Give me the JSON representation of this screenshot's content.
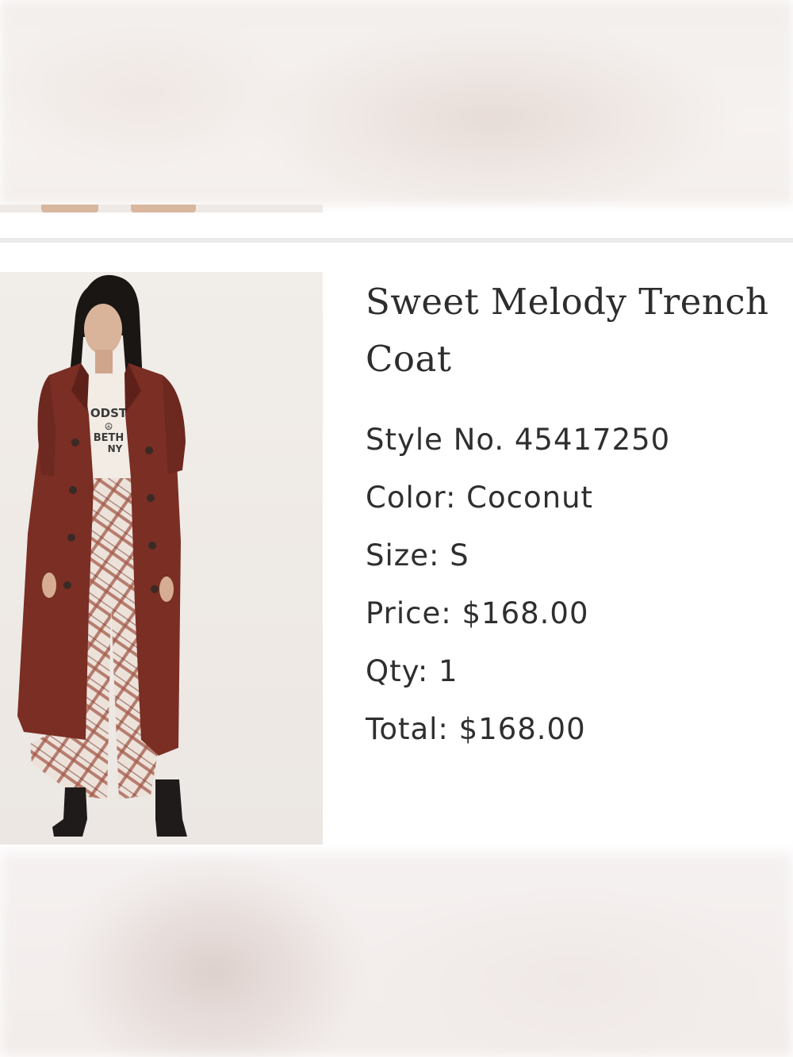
{
  "product": {
    "title": "Sweet Melody Trench Coat",
    "image_alt": "Model wearing a rust-red long trench coat over a graphic tee and plaid wide-leg pants with black combat boots",
    "details": {
      "style": "Style No. 45417250",
      "color": "Color: Coconut",
      "size": "Size: S",
      "price": "Price: $168.00",
      "qty": "Qty: 1",
      "total": "Total: $168.00"
    },
    "tee_print": [
      "ODST",
      "☮",
      "BETH",
      "NY"
    ]
  },
  "colors": {
    "coat": "#7a2e24",
    "coat_shadow": "#5e211a",
    "plaid_base": "#ece2da",
    "plaid_line": "#a45a4a",
    "boots": "#1e1b1a",
    "text": "#2f2f2f"
  }
}
